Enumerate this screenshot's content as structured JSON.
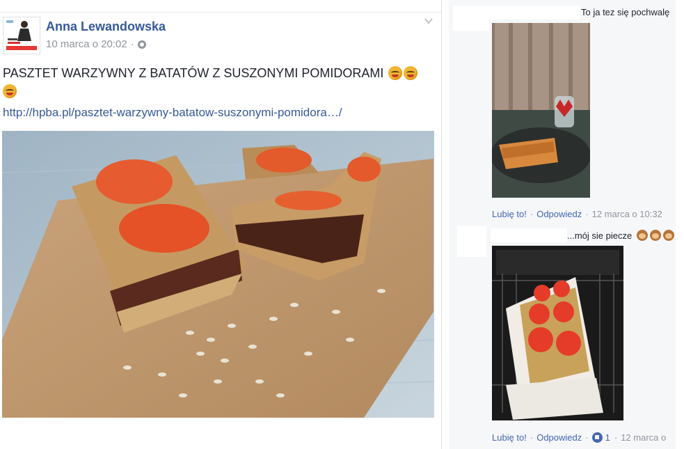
{
  "post": {
    "author": "Anna Lewandowska",
    "timestamp": "10 marca o 20:02",
    "separator": "·",
    "privacy_icon": "globe-icon",
    "menu_icon": "chevron-down-icon",
    "text": "PASZTET WARZYWNY Z BATATÓW Z SUSZONYMI POMIDORAMI",
    "emojis": [
      "yum-emoji",
      "yum-emoji",
      "yum-emoji"
    ],
    "link": "http://hpba.pl/pasztet-warzywny-batatow-suszonymi-pomidora…/"
  },
  "comments": [
    {
      "text": "To ja tez się pochwalę",
      "actions": {
        "like": "Lubię to!",
        "reply": "Odpowiedz",
        "time": "12 marca o 10:32"
      }
    },
    {
      "text": "...mój sie piecze",
      "emojis": [
        "monkey-emoji",
        "monkey-emoji",
        "monkey-emoji"
      ],
      "actions": {
        "like": "Lubię to!",
        "reply": "Odpowiedz",
        "reaction_count": "1",
        "time": "12 marca o"
      }
    }
  ],
  "colors": {
    "link": "#365899",
    "action": "#4267b2",
    "meta": "#90949c",
    "text": "#1d2129",
    "panel": "#f6f7f9"
  }
}
